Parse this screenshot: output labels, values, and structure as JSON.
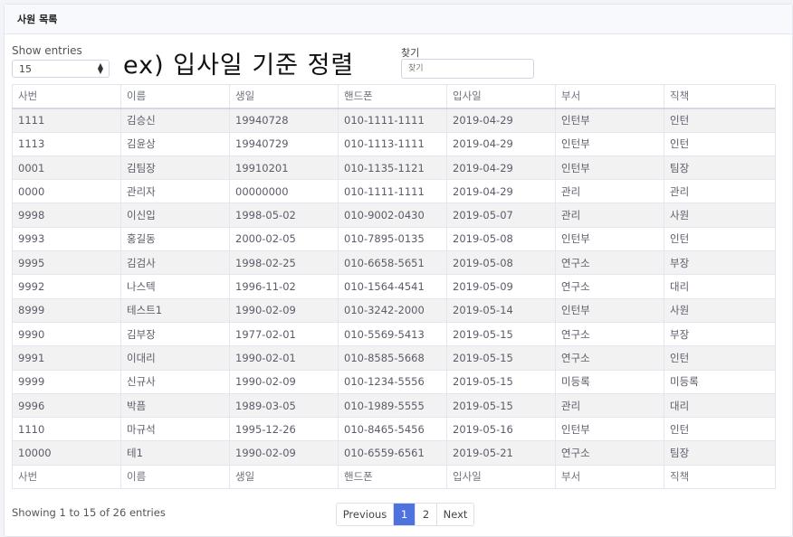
{
  "card": {
    "title": "사원 목록"
  },
  "controls": {
    "show_entries_label": "Show entries",
    "entries_value": "15",
    "note": "ex) 입사일 기준 정렬",
    "search_label": "찾기",
    "search_placeholder": "찾기"
  },
  "table": {
    "columns": [
      "사번",
      "이름",
      "생일",
      "핸드폰",
      "입사일",
      "부서",
      "직책"
    ],
    "rows": [
      [
        "1111",
        "김승신",
        "19940728",
        "010-1111-1111",
        "2019-04-29",
        "인턴부",
        "인턴"
      ],
      [
        "1113",
        "김윤상",
        "19940729",
        "010-1113-1111",
        "2019-04-29",
        "인턴부",
        "인턴"
      ],
      [
        "0001",
        "김팀장",
        "19910201",
        "010-1135-1121",
        "2019-04-29",
        "인턴부",
        "팀장"
      ],
      [
        "0000",
        "관리자",
        "00000000",
        "010-1111-1111",
        "2019-04-29",
        "관리",
        "관리"
      ],
      [
        "9998",
        "이신입",
        "1998-05-02",
        "010-9002-0430",
        "2019-05-07",
        "관리",
        "사원"
      ],
      [
        "9993",
        "홍길동",
        "2000-02-05",
        "010-7895-0135",
        "2019-05-08",
        "인턴부",
        "인턴"
      ],
      [
        "9995",
        "김검사",
        "1998-02-25",
        "010-6658-5651",
        "2019-05-08",
        "연구소",
        "부장"
      ],
      [
        "9992",
        "나스텍",
        "1996-11-02",
        "010-1564-4541",
        "2019-05-09",
        "연구소",
        "대리"
      ],
      [
        "8999",
        "테스트1",
        "1990-02-09",
        "010-3242-2000",
        "2019-05-14",
        "인턴부",
        "사원"
      ],
      [
        "9990",
        "김부장",
        "1977-02-01",
        "010-5569-5413",
        "2019-05-15",
        "연구소",
        "부장"
      ],
      [
        "9991",
        "이대리",
        "1990-02-01",
        "010-8585-5668",
        "2019-05-15",
        "연구소",
        "인턴"
      ],
      [
        "9999",
        "신규사",
        "1990-02-09",
        "010-1234-5556",
        "2019-05-15",
        "미등록",
        "미등록"
      ],
      [
        "9996",
        "박픔",
        "1989-03-05",
        "010-1989-5555",
        "2019-05-15",
        "관리",
        "대리"
      ],
      [
        "1110",
        "마규석",
        "1995-12-26",
        "010-8465-5456",
        "2019-05-16",
        "인턴부",
        "인턴"
      ],
      [
        "10000",
        "테1",
        "1990-02-09",
        "010-6559-6561",
        "2019-05-21",
        "연구소",
        "팀장"
      ]
    ]
  },
  "footer": {
    "info": "Showing 1 to 15 of 26 entries",
    "pagination": {
      "previous": "Previous",
      "pages": [
        "1",
        "2"
      ],
      "next": "Next",
      "active_page": "1"
    }
  },
  "colors": {
    "accent": "#4e73df",
    "stripe": "#f2f2f2",
    "border": "#e3e6f0"
  },
  "icons": {
    "select_arrows": "sort-arrows-icon"
  }
}
